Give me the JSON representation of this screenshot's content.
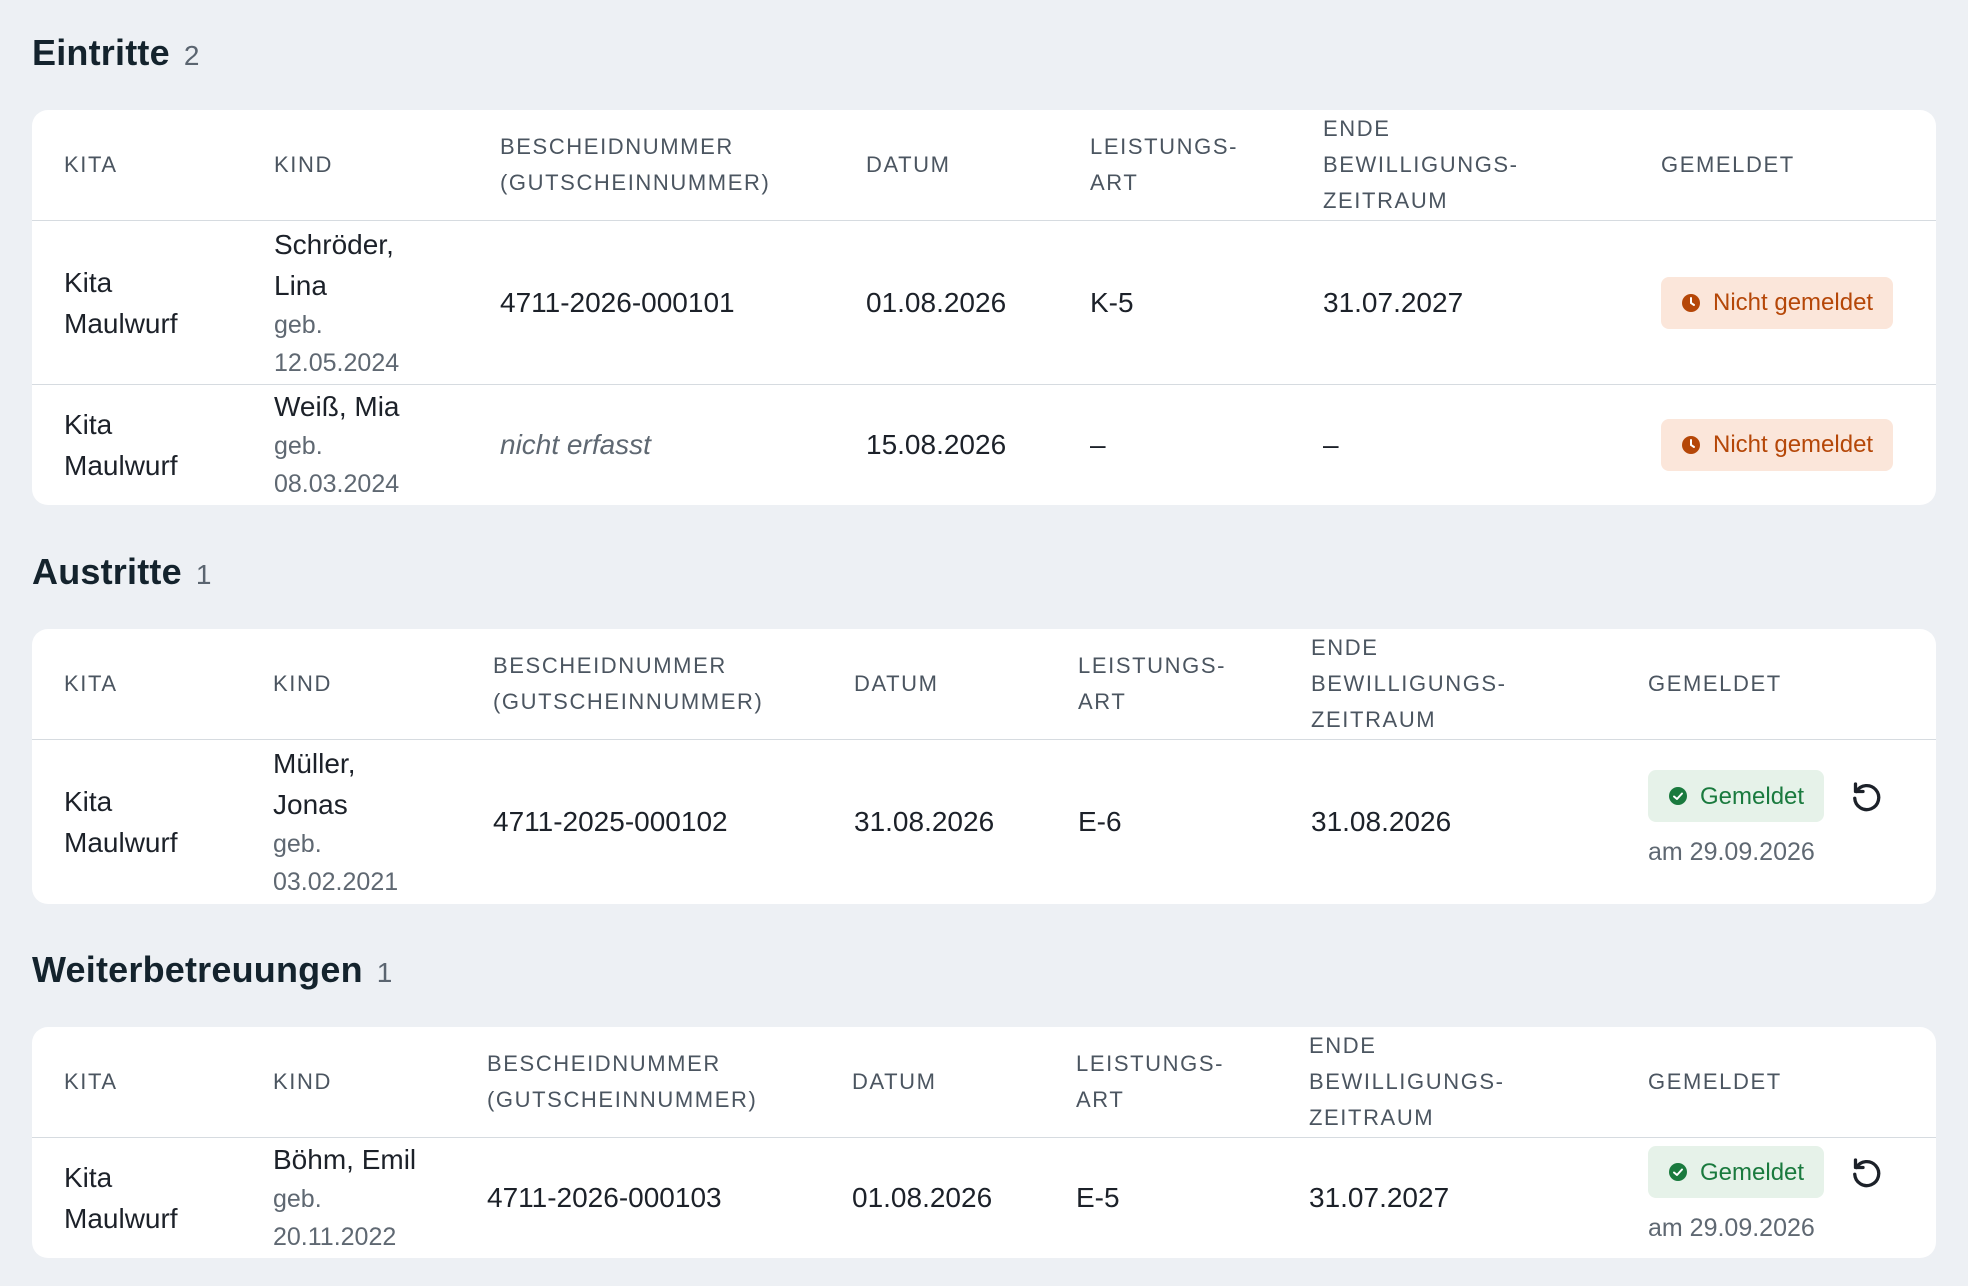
{
  "headers": {
    "kita": "KITA",
    "kind": "KIND",
    "bescheid_1": "BESCHEIDNUMMER",
    "bescheid_2": "(GUTSCHEINNUMMER)",
    "datum": "DATUM",
    "leistung_1": "LEISTUNGS-",
    "leistung_2": "ART",
    "ende_1": "ENDE",
    "ende_2": "BEWILLIGUNGS-",
    "ende_3": "ZEITRAUM",
    "gemeldet": "GEMELDET"
  },
  "sections": [
    {
      "title": "Eintritte",
      "count": "2",
      "rows": [
        {
          "kita_1": "Kita",
          "kita_2": "Maulwurf",
          "kind_1": "Schröder,",
          "kind_2": "Lina",
          "dob_1": "geb.",
          "dob_2": "12.05.2024",
          "bescheid": "4711-2026-000101",
          "datum": "01.08.2026",
          "leistungsart": "K-5",
          "ende": "31.07.2027",
          "status": "Nicht gemeldet"
        },
        {
          "kita_1": "Kita",
          "kita_2": "Maulwurf",
          "kind_1": "Weiß, Mia",
          "dob_1": "geb.",
          "dob_2": "08.03.2024",
          "bescheid": "nicht erfasst",
          "datum": "15.08.2026",
          "leistungsart": "–",
          "ende": "–",
          "status": "Nicht gemeldet"
        }
      ]
    },
    {
      "title": "Austritte",
      "count": "1",
      "rows": [
        {
          "kita_1": "Kita",
          "kita_2": "Maulwurf",
          "kind_1": "Müller,",
          "kind_2": "Jonas",
          "dob_1": "geb.",
          "dob_2": "03.02.2021",
          "bescheid": "4711-2025-000102",
          "datum": "31.08.2026",
          "leistungsart": "E-6",
          "ende": "31.08.2026",
          "status": "Gemeldet",
          "reported_date": "am 29.09.2026"
        }
      ]
    },
    {
      "title": "Weiterbetreuungen",
      "count": "1",
      "rows": [
        {
          "kita_1": "Kita",
          "kita_2": "Maulwurf",
          "kind_1": "Böhm, Emil",
          "dob_1": "geb.",
          "dob_2": "20.11.2022",
          "bescheid": "4711-2026-000103",
          "datum": "01.08.2026",
          "leistungsart": "E-5",
          "ende": "31.07.2027",
          "status": "Gemeldet",
          "reported_date": "am 29.09.2026"
        }
      ]
    }
  ],
  "colors": {
    "background": "#edf0f4",
    "warn_bg": "#fbe6da",
    "warn_fg": "#b54708",
    "ok_bg": "#e6f2e9",
    "ok_fg": "#1a7a3e"
  },
  "icons": {
    "warn": "clock-icon",
    "ok": "check-circle-icon",
    "undo": "undo-icon"
  }
}
